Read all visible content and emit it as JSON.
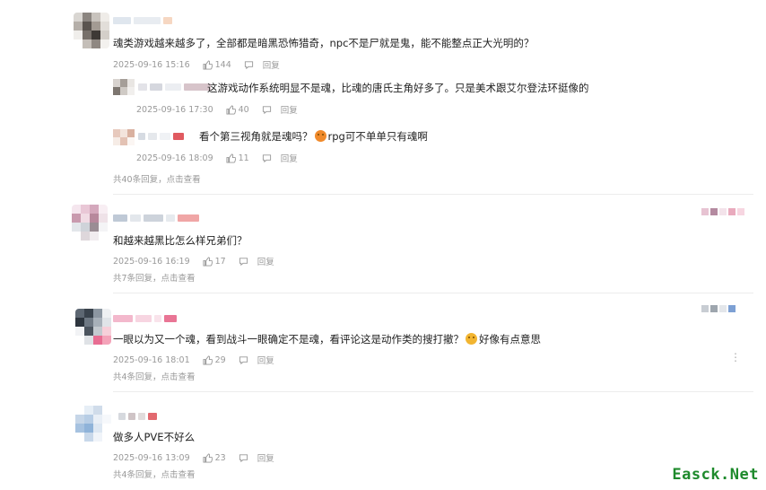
{
  "icons": {
    "like": "thumbs-up-icon",
    "reply": "comment-bubble-icon",
    "more": "more-vertical-icon"
  },
  "colors": {
    "text": "#222222",
    "meta": "#999999",
    "divider": "#ececec",
    "watermark": "#1e8a2c"
  },
  "comments": [
    {
      "text": "魂类游戏越来越多了，全部都是暗黑恐怖猎奇，npc不是尸就是鬼，能不能整点正大光明的？",
      "time": "2025-09-16 15:16",
      "likes": "144",
      "reply_label": "回复",
      "replies": [
        {
          "text": "这游戏动作系统明显不是魂，比魂的唐氏主角好多了。只是美术跟艾尔登法环挺像的",
          "time": "2025-09-16 17:30",
          "likes": "40",
          "reply_label": "回复"
        },
        {
          "text_before": "看个第三视角就是魂吗？",
          "emoji": "angry-face-icon",
          "text_after": "rpg可不单单只有魂啊",
          "time": "2025-09-16 18:09",
          "likes": "11",
          "reply_label": "回复"
        }
      ],
      "replies_link": "共40条回复，点击查看"
    },
    {
      "text": "和越来越黑比怎么样兄弟们？",
      "time": "2025-09-16 16:19",
      "likes": "17",
      "reply_label": "回复",
      "replies_link": "共7条回复，点击查看"
    },
    {
      "text_before": "一眼以为又一个魂，看到战斗一眼确定不是魂，看评论这是动作类的搜打撤？",
      "emoji": "laughing-face-icon",
      "text_after": "好像有点意思",
      "time": "2025-09-16 18:01",
      "likes": "29",
      "reply_label": "回复",
      "replies_link": "共4条回复，点击查看"
    },
    {
      "text": "做多人PVE不好么",
      "time": "2025-09-16 13:09",
      "likes": "23",
      "reply_label": "回复",
      "replies_link": "共4条回复，点击查看"
    }
  ],
  "watermark": "Easck.Net"
}
